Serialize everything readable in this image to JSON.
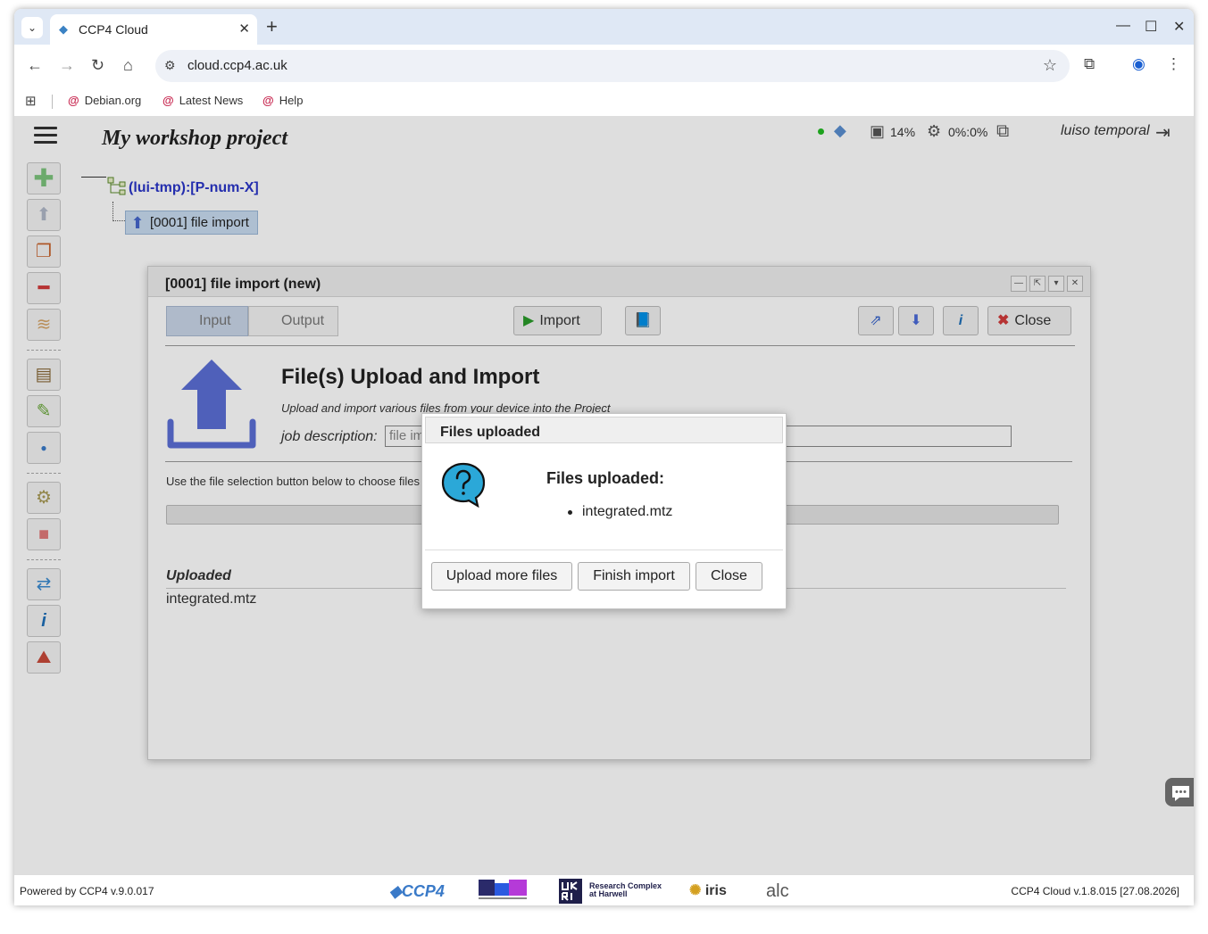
{
  "browser": {
    "tab_title": "CCP4 Cloud",
    "url": "cloud.ccp4.ac.uk",
    "bookmarks": [
      {
        "label": "Debian.org"
      },
      {
        "label": "Latest News"
      },
      {
        "label": "Help"
      }
    ]
  },
  "header": {
    "project_title": "My workshop project",
    "disk_usage": "14%",
    "cpu_usage": "0%:0%",
    "user": "luiso temporal",
    "status_color": "#22bb22"
  },
  "tree": {
    "root_label": "(lui-tmp):[P-num-X]",
    "node_label": "[0001] file import"
  },
  "job_dialog": {
    "title": "[0001] file import (new)",
    "tab_input": "Input",
    "tab_output": "Output",
    "import_label": "Import",
    "close_label": "Close",
    "heading": "File(s) Upload and Import",
    "subheading": "Upload and import various files from your device into the Project",
    "desc_label": "job description:",
    "desc_placeholder": "file import",
    "hint": "Use the file selection button below to choose files for upload",
    "uploaded_heading": "Uploaded",
    "uploaded_files": [
      "integrated.mtz"
    ]
  },
  "modal": {
    "title": "Files uploaded",
    "heading": "Files uploaded:",
    "files": [
      "integrated.mtz"
    ],
    "btn_upload_more": "Upload more files",
    "btn_finish": "Finish import",
    "btn_close": "Close"
  },
  "footer": {
    "left": "Powered by CCP4 v.9.0.017",
    "right": "CCP4 Cloud v.1.8.015 [27.08.2026]",
    "logo_ccp4": "CCP4",
    "logo_rch_line1": "Research Complex",
    "logo_rch_line2": "at Harwell",
    "logo_iris": "iris",
    "logo_alc": "alc"
  },
  "colors": {
    "accent_blue": "#2a35c8",
    "upload_icon": "#5b6fd6",
    "tree_selected": "#c8dcf0"
  }
}
